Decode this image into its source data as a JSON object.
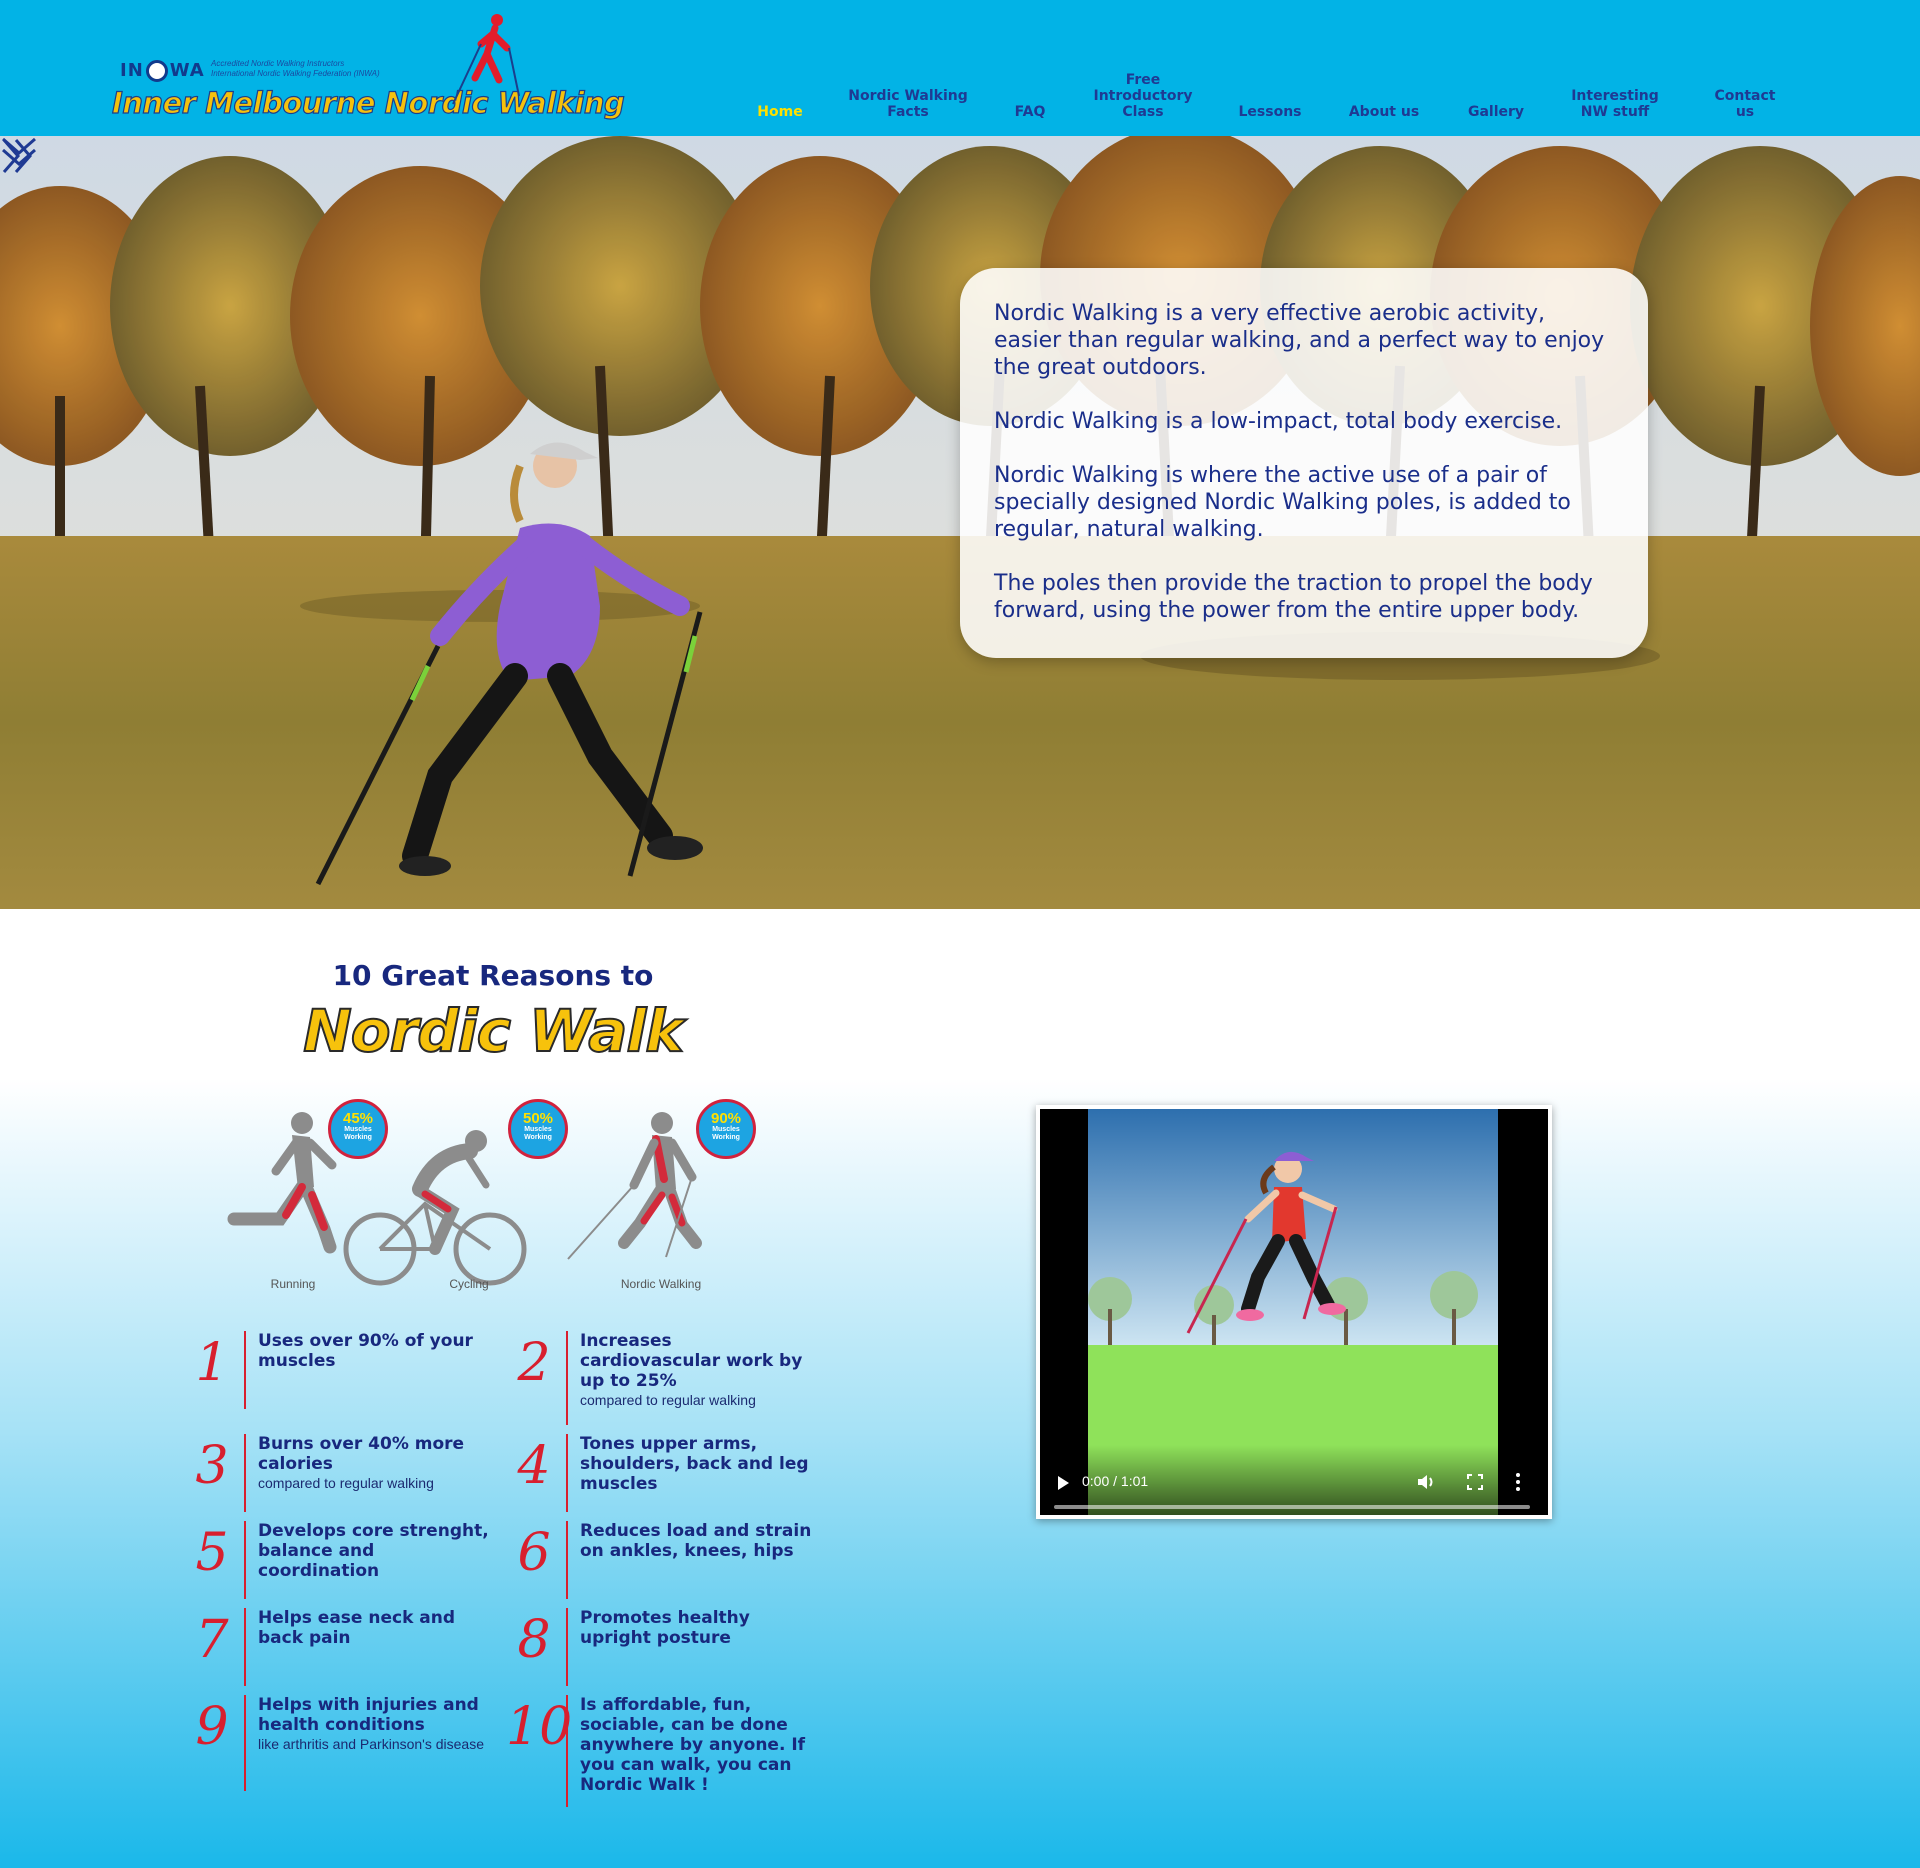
{
  "colors": {
    "header_bg": "#02b3e6",
    "nav_text": "#1f3a93",
    "nav_active": "#ffe000",
    "hero_text": "#1a2e8a",
    "accent_red": "#d81f2e",
    "title_yellow": "#f7c20c"
  },
  "logo": {
    "org_abbrev": "IN WA",
    "org_subtitle": "Accredited Nordic Walking Instructors\nInternational Nordic Walking Federation (INWA)",
    "title": "Inner Melbourne Nordic Walking"
  },
  "nav": {
    "items": [
      {
        "label": "Home",
        "active": true
      },
      {
        "label": "Nordic Walking\nFacts",
        "active": false
      },
      {
        "label": "FAQ",
        "active": false
      },
      {
        "label": "Free\nIntroductory\nClass",
        "active": false
      },
      {
        "label": "Lessons",
        "active": false
      },
      {
        "label": "About us",
        "active": false
      },
      {
        "label": "Gallery",
        "active": false
      },
      {
        "label": "Interesting\nNW stuff",
        "active": false
      },
      {
        "label": "Contact us",
        "active": false
      }
    ]
  },
  "hero": {
    "paragraphs": [
      "Nordic Walking is a very effective aerobic activity, easier than regular walking, and a perfect way to enjoy the great outdoors.",
      "Nordic Walking is a low-impact, total body exercise.",
      "Nordic Walking is where the active use of a pair of specially designed Nordic Walking poles, is added to regular, natural walking.",
      "The poles then provide the traction to propel the body forward, using the power from the entire upper body."
    ],
    "next_icon": "double-chevron-right-icon",
    "down_icon": "double-chevron-down-icon"
  },
  "reasons": {
    "title_line1": "10 Great Reasons to",
    "title_line2": "Nordic Walk",
    "sports": [
      {
        "caption": "Running",
        "percent": "45%",
        "badge_label": "Muscles\nWorking"
      },
      {
        "caption": "Cycling",
        "percent": "50%",
        "badge_label": "Muscles\nWorking"
      },
      {
        "caption": "Nordic Walking",
        "percent": "90%",
        "badge_label": "Muscles\nWorking"
      }
    ],
    "items": [
      {
        "num": "1",
        "title": "Uses over 90% of your muscles",
        "sub": ""
      },
      {
        "num": "2",
        "title": "Increases cardiovascular work by up to 25%",
        "sub": "compared to regular walking"
      },
      {
        "num": "3",
        "title": "Burns over 40% more calories",
        "sub": "compared to regular walking"
      },
      {
        "num": "4",
        "title": "Tones upper arms, shoulders, back and leg muscles",
        "sub": ""
      },
      {
        "num": "5",
        "title": "Develops core strenght, balance and coordination",
        "sub": ""
      },
      {
        "num": "6",
        "title": "Reduces load and strain on ankles, knees, hips",
        "sub": ""
      },
      {
        "num": "7",
        "title": "Helps ease neck and back pain",
        "sub": ""
      },
      {
        "num": "8",
        "title": "Promotes healthy upright posture",
        "sub": ""
      },
      {
        "num": "9",
        "title": "Helps with injuries and health conditions",
        "sub": "like arthritis and Parkinson's disease"
      },
      {
        "num": "10",
        "title": "Is affordable, fun, sociable, can be done anywhere by anyone. If you can walk, you can Nordic Walk !",
        "sub": ""
      }
    ]
  },
  "video": {
    "time": "0:00 / 1:01",
    "progress": 0
  }
}
